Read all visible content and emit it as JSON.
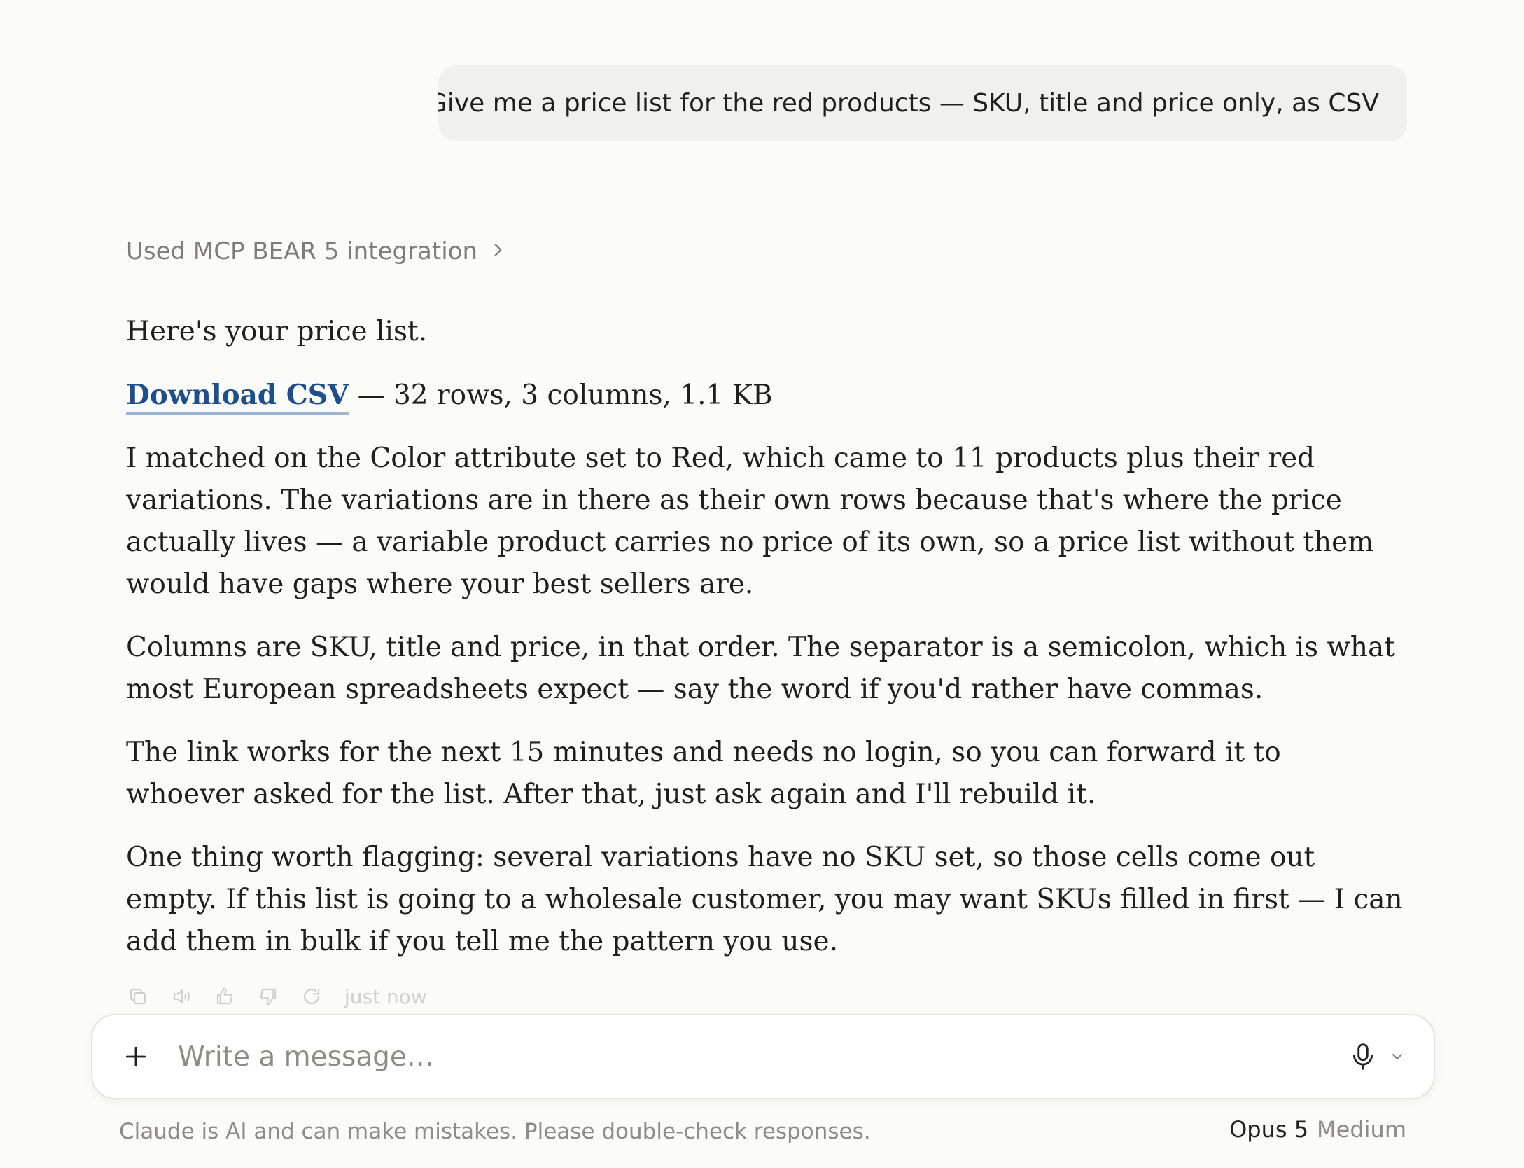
{
  "user_message": "Give me a price list for the red products — SKU, title and price only, as CSV",
  "tool_use": {
    "label": "Used MCP BEAR 5 integration",
    "icon": "chevron-right-icon"
  },
  "assistant": {
    "intro": "Here's your price list.",
    "download": {
      "link_text": "Download CSV",
      "details": " — 32 rows, 3 columns, 1.1 KB"
    },
    "paragraphs": [
      "I matched on the Color attribute set to Red, which came to 11 products plus their red variations. The variations are in there as their own rows because that's where the price actually lives — a variable product carries no price of its own, so a price list without them would have gaps where your best sellers are.",
      "Columns are SKU, title and price, in that order. The separator is a semicolon, which is what most European spreadsheets expect — say the word if you'd rather have commas.",
      "The link works for the next 15 minutes and needs no login, so you can forward it to whoever asked for the list. After that, just ask again and I'll rebuild it.",
      "One thing worth flagging: several variations have no SKU set, so those cells come out empty. If this list is going to a wholesale customer, you may want SKUs filled in first — I can add them in bulk if you tell me the pattern you use."
    ]
  },
  "message_actions": {
    "icons": [
      "copy-icon",
      "speaker-icon",
      "thumbs-up-icon",
      "thumbs-down-icon",
      "retry-icon"
    ],
    "timestamp": "just now"
  },
  "composer": {
    "placeholder": "Write a message…",
    "value": ""
  },
  "footer": {
    "disclaimer": "Claude is AI and can make mistakes. Please double-check responses.",
    "model_name": "Opus 5",
    "model_effort": "Medium"
  },
  "colors": {
    "background": "#fbfbf9",
    "user_bubble": "#f0f0ee",
    "link": "#1e4f8c",
    "muted_text": "#8d8c88"
  }
}
